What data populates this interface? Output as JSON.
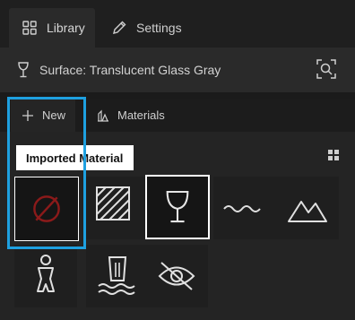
{
  "tabs": {
    "library_label": "Library",
    "settings_label": "Settings"
  },
  "surface": {
    "label": "Surface: Translucent Glass Gray"
  },
  "subtabs": {
    "new_label": "New",
    "materials_label": "Materials"
  },
  "tooltip": {
    "text": "Imported Material"
  },
  "tiles": [
    {
      "name": "none-material",
      "icon": "no-material-icon"
    },
    {
      "name": "hatch-material",
      "icon": "hatch-icon"
    },
    {
      "name": "glass-material",
      "icon": "wine-glass-icon",
      "selected": true
    },
    {
      "name": "water-surface-material",
      "icon": "wave-icon"
    },
    {
      "name": "terrain-material",
      "icon": "mountain-icon"
    },
    {
      "name": "person-material",
      "icon": "person-icon"
    },
    {
      "name": "waterfall-material",
      "icon": "waterfall-icon"
    },
    {
      "name": "hidden-material",
      "icon": "eye-off-icon"
    }
  ],
  "colors": {
    "accent_highlight": "#1ea0e0",
    "none_icon": "#8b1a1a"
  }
}
